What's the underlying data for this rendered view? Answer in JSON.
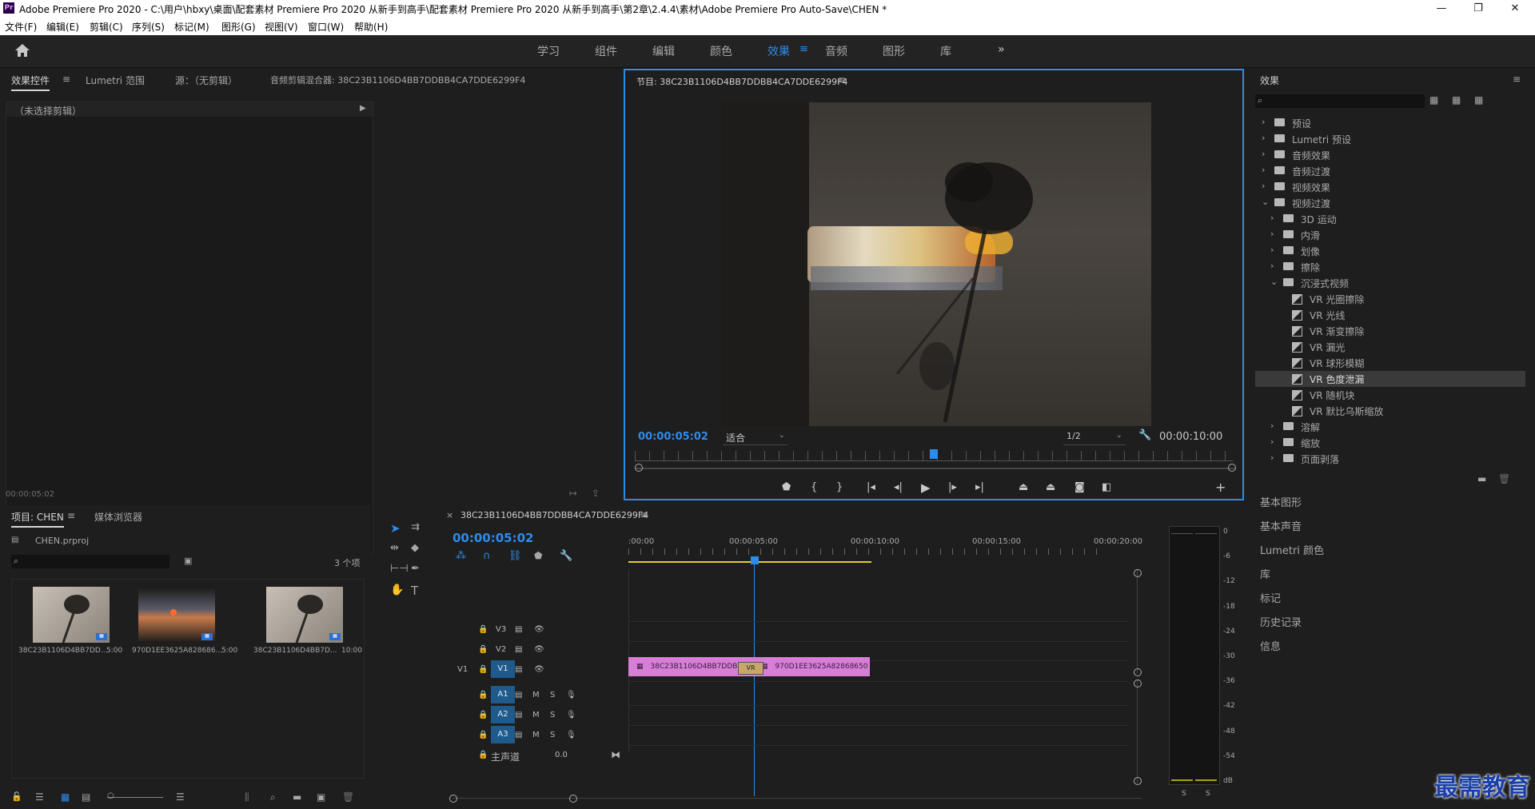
{
  "window": {
    "title": "Adobe Premiere Pro 2020 - C:\\用户\\hbxy\\桌面\\配套素材 Premiere Pro 2020 从新手到高手\\配套素材 Premiere Pro 2020 从新手到高手\\第2章\\2.4.4\\素材\\Adobe Premiere Pro Auto-Save\\CHEN *",
    "app_icon": "Pr",
    "minimize": "—",
    "maximize": "❐",
    "close": "✕"
  },
  "menu": [
    "文件(F)",
    "编辑(E)",
    "剪辑(C)",
    "序列(S)",
    "标记(M)",
    "图形(G)",
    "视图(V)",
    "窗口(W)",
    "帮助(H)"
  ],
  "workspaces": {
    "items": [
      "学习",
      "组件",
      "编辑",
      "颜色",
      "效果",
      "音频",
      "图形",
      "库"
    ],
    "active": "效果",
    "more": "»"
  },
  "source_panel": {
    "tabs": [
      "效果控件",
      "Lumetri 范围",
      "源：（无剪辑）",
      "音频剪辑混合器: 38C23B1106D4BB7DDBB4CA7DDE6299F4"
    ],
    "no_clip": "（未选择剪辑）",
    "timecode": "00:00:05:02"
  },
  "program": {
    "title": "节目: 38C23B1106D4BB7DDBB4CA7DDE6299F4",
    "timecode": "00:00:05:02",
    "fit": "适合",
    "resolution": "1/2",
    "duration": "00:00:10:00",
    "playhead_fraction": 0.5
  },
  "effects": {
    "title": "效果",
    "tree": [
      {
        "label": "预设",
        "level": 0,
        "kind": "folder"
      },
      {
        "label": "Lumetri 预设",
        "level": 0,
        "kind": "folder"
      },
      {
        "label": "音频效果",
        "level": 0,
        "kind": "folder"
      },
      {
        "label": "音频过渡",
        "level": 0,
        "kind": "folder"
      },
      {
        "label": "视频效果",
        "level": 0,
        "kind": "folder"
      },
      {
        "label": "视频过渡",
        "level": 0,
        "kind": "folder-open"
      },
      {
        "label": "3D 运动",
        "level": 1,
        "kind": "folder"
      },
      {
        "label": "内滑",
        "level": 1,
        "kind": "folder"
      },
      {
        "label": "划像",
        "level": 1,
        "kind": "folder"
      },
      {
        "label": "擦除",
        "level": 1,
        "kind": "folder"
      },
      {
        "label": "沉浸式视频",
        "level": 1,
        "kind": "folder-open"
      },
      {
        "label": "VR 光圈擦除",
        "level": 2,
        "kind": "fx"
      },
      {
        "label": "VR 光线",
        "level": 2,
        "kind": "fx"
      },
      {
        "label": "VR 渐变擦除",
        "level": 2,
        "kind": "fx"
      },
      {
        "label": "VR 漏光",
        "level": 2,
        "kind": "fx"
      },
      {
        "label": "VR 球形模糊",
        "level": 2,
        "kind": "fx"
      },
      {
        "label": "VR 色度泄漏",
        "level": 2,
        "kind": "fx",
        "selected": true
      },
      {
        "label": "VR 随机块",
        "level": 2,
        "kind": "fx"
      },
      {
        "label": "VR 默比乌斯缩放",
        "level": 2,
        "kind": "fx"
      },
      {
        "label": "溶解",
        "level": 1,
        "kind": "folder"
      },
      {
        "label": "缩放",
        "level": 1,
        "kind": "folder"
      },
      {
        "label": "页面剥落",
        "level": 1,
        "kind": "folder"
      }
    ]
  },
  "side_panels": [
    "基本图形",
    "基本声音",
    "Lumetri 颜色",
    "库",
    "标记",
    "历史记录",
    "信息"
  ],
  "project": {
    "tabs": [
      "项目: CHEN",
      "媒体浏览器"
    ],
    "file": "CHEN.prproj",
    "count": "3 个项",
    "clips": [
      {
        "name": "38C23B1106D4BB7DD...",
        "duration": "5:00"
      },
      {
        "name": "970D1EE3625A828686...",
        "duration": "5:00"
      },
      {
        "name": "38C23B1106D4BB7D...",
        "duration": "10:00"
      }
    ]
  },
  "timeline": {
    "sequence": "38C23B1106D4BB7DDBB4CA7DDE6299F4",
    "timecode": "00:00:05:02",
    "ruler": [
      ":00:00",
      "00:00:05:00",
      "00:00:10:00",
      "00:00:15:00",
      "00:00:20:00"
    ],
    "video_tracks": [
      "V3",
      "V2",
      "V1"
    ],
    "audio_tracks": [
      "A1",
      "A2",
      "A3"
    ],
    "source_patch": "V1",
    "master": "主声道",
    "master_value": "0.0",
    "clip1": "38C23B1106D4BB7DDBB",
    "clip2": "970D1EE3625A82868650",
    "transition": "VR",
    "mute": "M",
    "solo": "S"
  },
  "meter": {
    "scale": [
      "0",
      "-6",
      "-12",
      "-18",
      "-24",
      "-30",
      "-36",
      "-42",
      "-48",
      "-54",
      "dB"
    ],
    "solo_left": "S",
    "solo_right": "S"
  },
  "watermark": "最需教育"
}
